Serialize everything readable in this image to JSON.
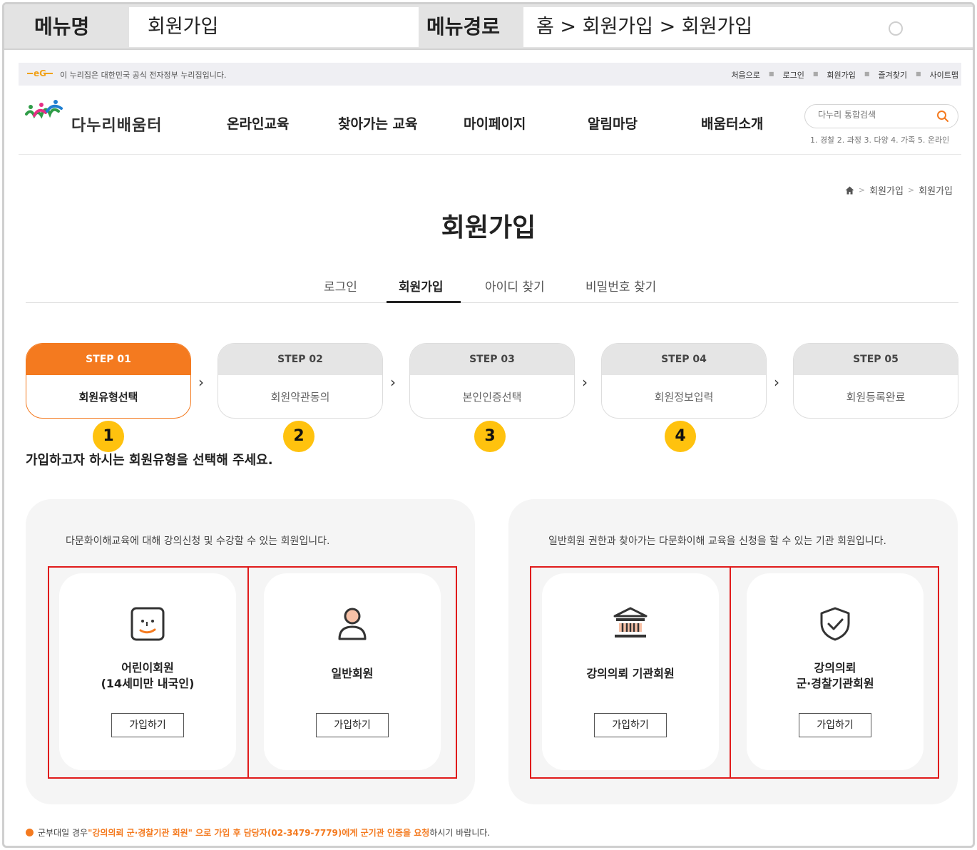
{
  "spec": {
    "menu_name_label": "메뉴명",
    "menu_name": "회원가입",
    "menu_path_label": "메뉴경로",
    "menu_path": "홈 > 회원가입 > 회원가입"
  },
  "gov_banner": {
    "message": "이 누리집은 대한민국 공식 전자정부 누리집입니다.",
    "links": [
      "처음으로",
      "로그인",
      "회원가입",
      "즐겨찾기",
      "사이트맵"
    ]
  },
  "header": {
    "logo_text": "다누리배움터",
    "nav": [
      "온라인교육",
      "찾아가는 교육",
      "마이페이지",
      "알림마당",
      "배움터소개"
    ],
    "search_placeholder": "다누리 통합검색",
    "popular_keywords": "1. 경찰 2. 과정 3. 다양 4. 가족 5. 온라인"
  },
  "breadcrumb": [
    "회원가입",
    "회원가입"
  ],
  "page_title": "회원가입",
  "tabs": [
    "로그인",
    "회원가입",
    "아이디 찾기",
    "비밀번호 찾기"
  ],
  "active_tab": "회원가입",
  "steps": [
    {
      "step": "STEP 01",
      "label": "회원유형선택",
      "active": true
    },
    {
      "step": "STEP 02",
      "label": "회원약관동의",
      "active": false
    },
    {
      "step": "STEP 03",
      "label": "본인인증선택",
      "active": false
    },
    {
      "step": "STEP 04",
      "label": "회원정보입력",
      "active": false
    },
    {
      "step": "STEP 05",
      "label": "회원등록완료",
      "active": false
    }
  ],
  "badges": [
    "1",
    "2",
    "3",
    "4"
  ],
  "instruction": "가입하고자 하시는 회원유형을 선택해 주세요.",
  "panels": [
    {
      "description": "다문화이해교육에 대해 강의신청 및 수강할 수 있는 회원입니다.",
      "cards": [
        {
          "icon": "child-face-icon",
          "name_line1": "어린이회원",
          "name_line2": "(14세미만 내국인)",
          "button": "가입하기"
        },
        {
          "icon": "person-icon",
          "name_line1": "일반회원",
          "name_line2": "",
          "button": "가입하기"
        }
      ]
    },
    {
      "description": "일반회원 권한과 찾아가는 다문화이해 교육을 신청을 할 수 있는 기관 회원입니다.",
      "cards": [
        {
          "icon": "institution-building-icon",
          "name_line1": "강의의뢰 기관회원",
          "name_line2": "",
          "button": "가입하기"
        },
        {
          "icon": "shield-check-icon",
          "name_line1": "강의의뢰",
          "name_line2": "군·경찰기관회원",
          "button": "가입하기"
        }
      ]
    }
  ],
  "footer_note": {
    "prefix": "군부대일 경우 ",
    "highlight": "\"강의의뢰 군·경찰기관 회원\" 으로 가입 후 담당자(02-3479-7779)에게 군기관 인증을 요청",
    "suffix": "하시기 바랍니다."
  },
  "colors": {
    "accent": "#f47a1f",
    "badge": "#ffc20e",
    "highlight_box": "#e01b1b"
  }
}
